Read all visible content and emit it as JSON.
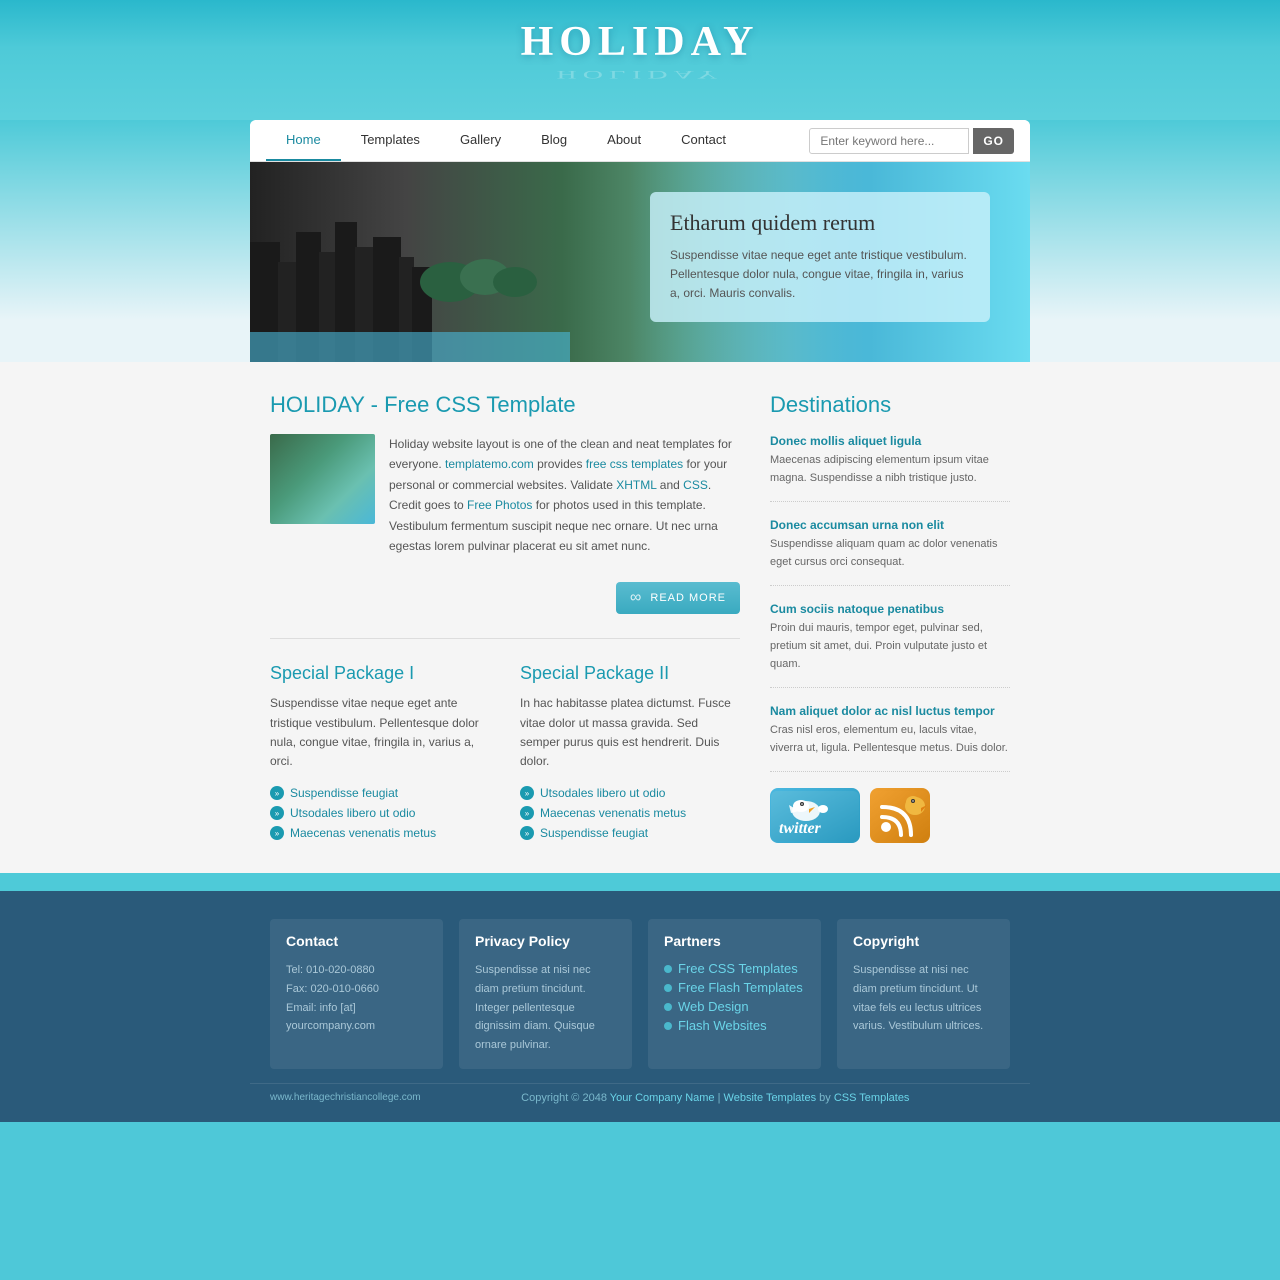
{
  "site": {
    "title": "HOLIDAY",
    "url": "www.heritagechristiancollege.com"
  },
  "nav": {
    "items": [
      {
        "label": "Home",
        "active": true
      },
      {
        "label": "Templates",
        "active": false
      },
      {
        "label": "Gallery",
        "active": false
      },
      {
        "label": "Blog",
        "active": false
      },
      {
        "label": "About",
        "active": false
      },
      {
        "label": "Contact",
        "active": false
      }
    ],
    "search_placeholder": "Enter keyword here...",
    "search_btn": "GO"
  },
  "hero": {
    "heading": "Etharum quidem rerum",
    "body": "Suspendisse vitae neque eget ante tristique vestibulum. Pellentesque dolor nula, congue vitae, fringila in, varius a, orci. Mauris convalis."
  },
  "main": {
    "title": "HOLIDAY - Free CSS Template",
    "about_text": "Holiday website layout is one of the clean and neat templates for everyone. templatemo.com provides free css templates for your personal or commercial websites. Validate XHTML and CSS. Credit goes to Free Photos for photos used in this template. Vestibulum fermentum suscipit neque nec ornare. Ut nec urna egestas lorem pulvinar placerat eu sit amet nunc.",
    "read_more_label": "READ MORE",
    "packages": [
      {
        "title": "Special Package I",
        "desc": "Suspendisse vitae neque eget ante tristique vestibulum. Pellentesque dolor nula, congue vitae, fringila in, varius a, orci.",
        "list": [
          "Suspendisse feugiat",
          "Utsodales libero ut odio",
          "Maecenas venenatis metus"
        ]
      },
      {
        "title": "Special Package II",
        "desc": "In hac habitasse platea dictumst. Fusce vitae dolor ut massa gravida. Sed semper purus quis est hendrerit. Duis dolor.",
        "list": [
          "Utsodales libero ut odio",
          "Maecenas venenatis metus",
          "Suspendisse feugiat"
        ]
      }
    ]
  },
  "destinations": {
    "title": "Destinations",
    "items": [
      {
        "link": "Donec mollis aliquet ligula",
        "desc": "Maecenas adipiscing elementum ipsum vitae magna. Suspendisse a nibh tristique justo."
      },
      {
        "link": "Donec accumsan urna non elit",
        "desc": "Suspendisse aliquam quam ac dolor venenatis eget cursus orci consequat."
      },
      {
        "link": "Cum sociis natoque penatibus",
        "desc": "Proin dui mauris, tempor eget, pulvinar sed, pretium sit amet, dui. Proin vulputate justo et quam."
      },
      {
        "link": "Nam aliquet dolor ac nisl luctus tempor",
        "desc": "Cras nisl eros, elementum eu, laculs vitae, viverra ut, ligula. Pellentesque metus. Duis dolor."
      }
    ]
  },
  "footer": {
    "columns": [
      {
        "title": "Contact",
        "lines": [
          "Tel: 010-020-0880",
          "Fax: 020-010-0660",
          "Email: info [at] yourcompany.com"
        ]
      },
      {
        "title": "Privacy Policy",
        "text": "Suspendisse at nisi nec diam pretium tincidunt. Integer pellentesque dignissim diam. Quisque ornare pulvinar."
      },
      {
        "title": "Partners",
        "links": [
          "Free CSS Templates",
          "Free Flash Templates",
          "Web Design",
          "Flash Websites"
        ]
      },
      {
        "title": "Copyright",
        "text": "Suspendisse at nisi nec diam pretium tincidunt. Ut vitae fels eu lectus ultrices varius. Vestibulum ultrices."
      }
    ],
    "copyright": "Copyright © 2048",
    "company_name": "Your Company Name",
    "sep1": "|",
    "website_templates": "Website Templates",
    "sep2": "by",
    "css_templates": "CSS Templates"
  }
}
